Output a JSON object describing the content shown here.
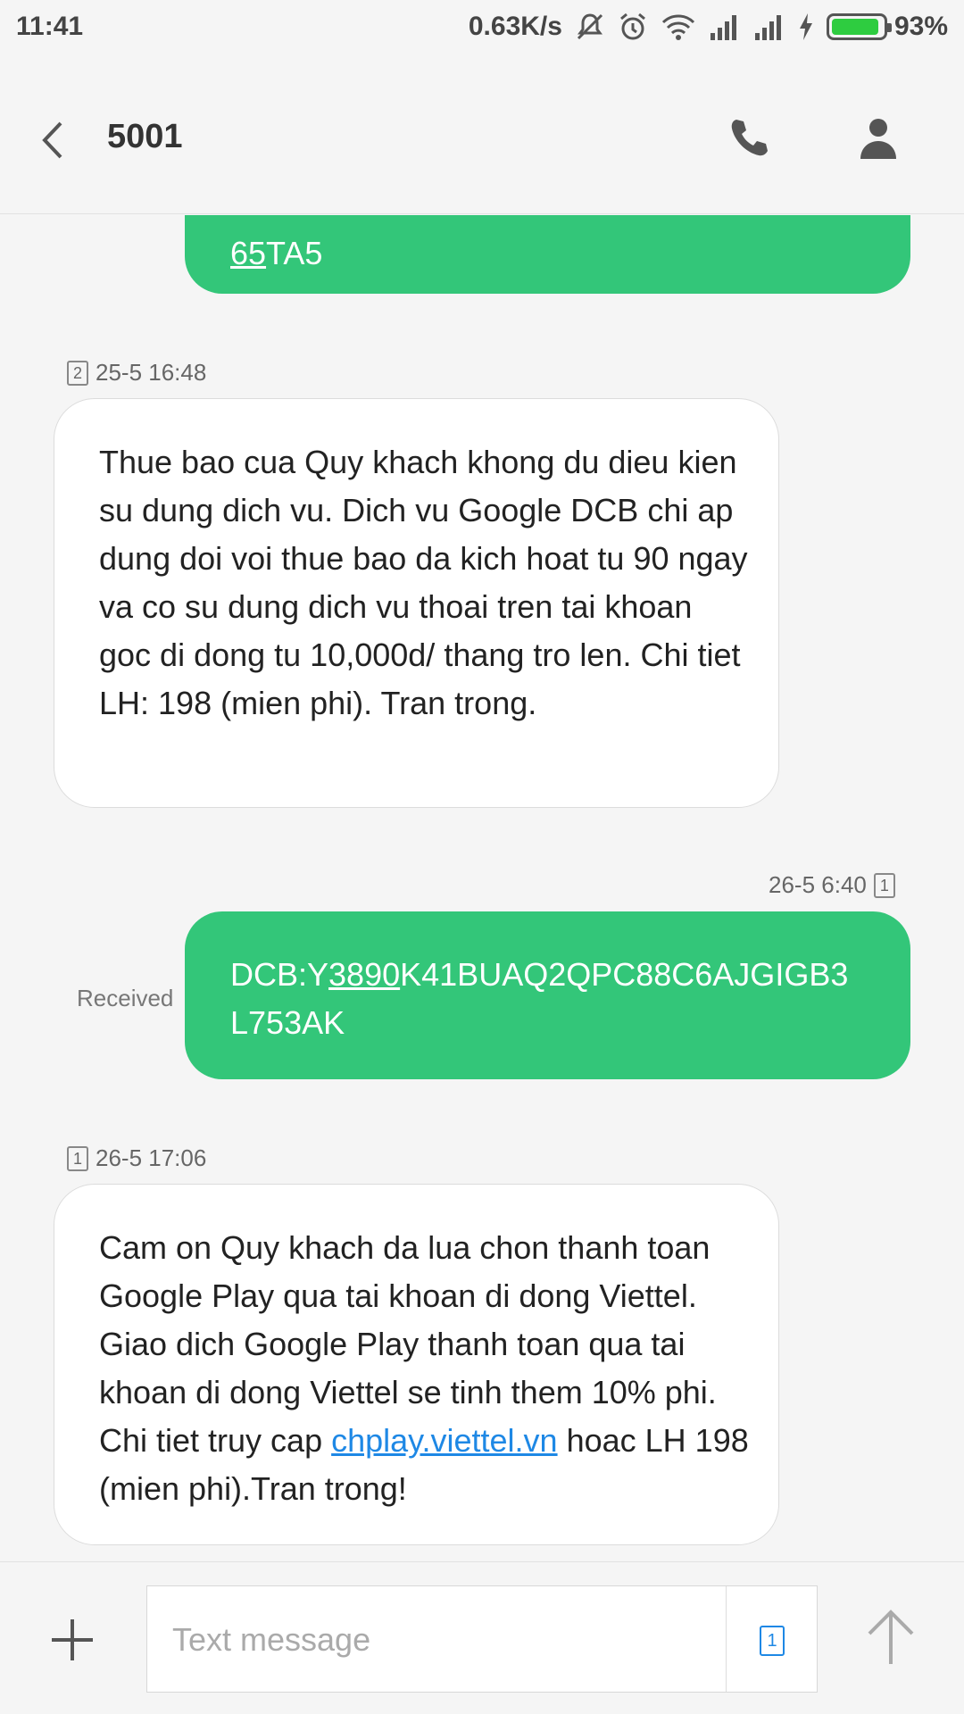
{
  "status_bar": {
    "time": "11:41",
    "network_speed": "0.63K/s",
    "battery_percent": "93%",
    "battery_level": 0.93,
    "icons": [
      "mute-icon",
      "alarm-icon",
      "wifi-icon",
      "signal-icon",
      "signal-icon",
      "charging-icon",
      "battery-icon"
    ]
  },
  "header": {
    "title": "5001",
    "back_icon": "chevron-left-icon",
    "call_icon": "phone-icon",
    "contact_icon": "person-icon"
  },
  "messages": [
    {
      "direction": "outgoing",
      "text_underlined": "65",
      "text_rest": "TA5"
    },
    {
      "direction": "incoming",
      "sim": "2",
      "timestamp": "25-5 16:48",
      "text": "Thue bao cua Quy khach khong du dieu kien su dung dich vu. Dich vu Google DCB chi ap dung doi voi thue bao da kich hoat tu 90 ngay va co su dung dich vu thoai tren tai khoan goc di dong tu 10,000d/ thang tro len. Chi tiet LH: 198 (mien phi). Tran trong."
    },
    {
      "direction": "outgoing",
      "sim": "1",
      "timestamp": "26-5 6:40",
      "status": "Received",
      "text_prefix": "DCB:Y",
      "text_underlined": "3890",
      "text_suffix": "K41BUAQ2QPC88C6AJGIGB3 L753AK"
    },
    {
      "direction": "incoming",
      "sim": "1",
      "timestamp": "26-5 17:06",
      "text_before_link": "Cam on Quy khach da lua chon thanh toan Google Play qua tai khoan di dong Viettel. Giao dich Google Play thanh toan qua tai khoan di dong Viettel se tinh them 10% phi. Chi tiet truy cap ",
      "link_text": "chplay.viettel.vn",
      "text_after_link": " hoac LH 198 (mien phi).Tran trong!"
    }
  ],
  "compose": {
    "placeholder": "Text message",
    "sim": "1",
    "add_icon": "plus-icon",
    "send_icon": "arrow-up-icon"
  },
  "colors": {
    "outgoing_bubble": "#33c679",
    "link": "#1e88e5",
    "background": "#f5f5f5"
  }
}
